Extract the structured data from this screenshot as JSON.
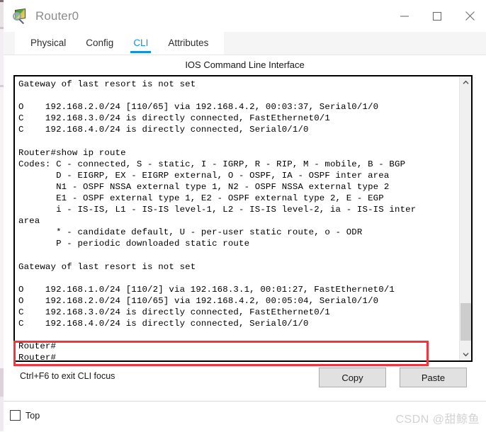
{
  "window": {
    "title": "Router0",
    "icon": "router-magnifier-icon",
    "controls": {
      "minimize": "minimize-icon",
      "maximize": "maximize-icon",
      "close": "close-icon"
    }
  },
  "tabs": [
    {
      "label": "Physical",
      "active": false
    },
    {
      "label": "Config",
      "active": false
    },
    {
      "label": "CLI",
      "active": true
    },
    {
      "label": "Attributes",
      "active": false
    }
  ],
  "panel": {
    "heading": "IOS Command Line Interface"
  },
  "terminal": {
    "lines": [
      "Gateway of last resort is not set",
      "",
      "O    192.168.2.0/24 [110/65] via 192.168.4.2, 00:03:37, Serial0/1/0",
      "C    192.168.3.0/24 is directly connected, FastEthernet0/1",
      "C    192.168.4.0/24 is directly connected, Serial0/1/0",
      "",
      "Router#show ip route",
      "Codes: C - connected, S - static, I - IGRP, R - RIP, M - mobile, B - BGP",
      "       D - EIGRP, EX - EIGRP external, O - OSPF, IA - OSPF inter area",
      "       N1 - OSPF NSSA external type 1, N2 - OSPF NSSA external type 2",
      "       E1 - OSPF external type 1, E2 - OSPF external type 2, E - EGP",
      "       i - IS-IS, L1 - IS-IS level-1, L2 - IS-IS level-2, ia - IS-IS inter",
      "area",
      "       * - candidate default, U - per-user static route, o - ODR",
      "       P - periodic downloaded static route",
      "",
      "Gateway of last resort is not set",
      "",
      "O    192.168.1.0/24 [110/2] via 192.168.3.1, 00:01:27, FastEthernet0/1",
      "O    192.168.2.0/24 [110/65] via 192.168.4.2, 00:05:04, Serial0/1/0",
      "C    192.168.3.0/24 is directly connected, FastEthernet0/1",
      "C    192.168.4.0/24 is directly connected, Serial0/1/0",
      "",
      "Router#",
      "Router#"
    ],
    "scrollbar": {
      "up_arrow": "chevron-up-icon",
      "down_arrow": "chevron-down-icon"
    }
  },
  "highlight": {
    "color": "#f5333f",
    "lines": [
      "O    192.168.1.0/24 [110/2] via 192.168.3.1, 00:01:27, FastEthernet0/1",
      "O    192.168.2.0/24 [110/65] via 192.168.4.2, 00:05:04, Serial0/1/0"
    ]
  },
  "bottom": {
    "hint": "Ctrl+F6 to exit CLI focus",
    "copy_label": "Copy",
    "paste_label": "Paste"
  },
  "footer": {
    "top_label": "Top",
    "watermark": "CSDN @甜鲸鱼"
  },
  "colors": {
    "accent": "#1294d4",
    "highlight": "#f5333f",
    "title_text": "#8c8c8c"
  }
}
